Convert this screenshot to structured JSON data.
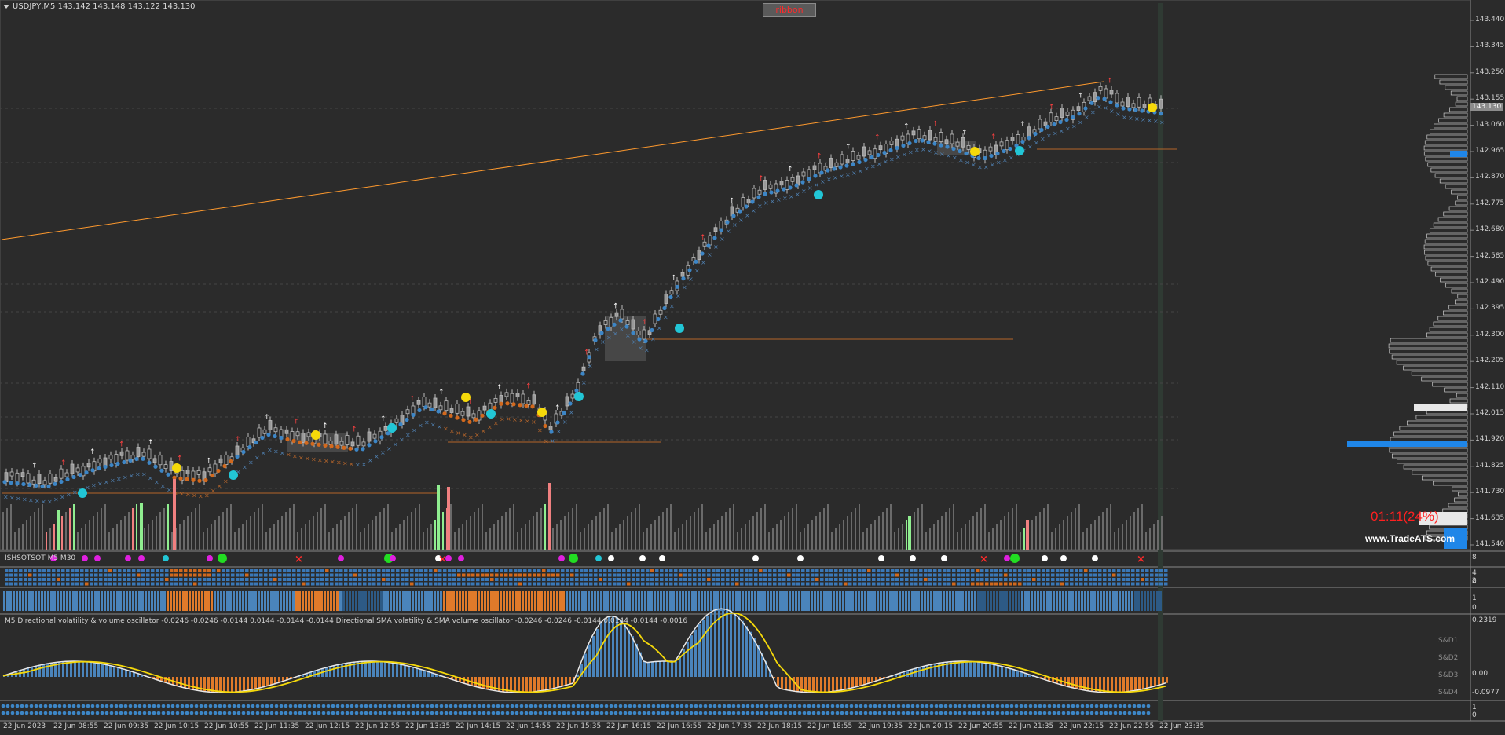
{
  "chart": {
    "symbol_header": "USDJPY,M5  143.142 143.148 143.122 143.130",
    "ribbon_button": "ribbon",
    "current_price": "143.130",
    "timer": "01:11(24%)",
    "watermark": "www.TradeATS.com"
  },
  "price_axis": {
    "labels": [
      "143.440",
      "143.345",
      "143.250",
      "143.155",
      "143.060",
      "142.965",
      "142.870",
      "142.775",
      "142.680",
      "142.585",
      "142.490",
      "142.395",
      "142.300",
      "142.205",
      "142.110",
      "142.015",
      "141.920",
      "141.825",
      "141.730",
      "141.635",
      "141.540"
    ]
  },
  "time_axis": {
    "labels": [
      "22 Jun 2023",
      "22 Jun 08:55",
      "22 Jun 09:35",
      "22 Jun 10:15",
      "22 Jun 10:55",
      "22 Jun 11:35",
      "22 Jun 12:15",
      "22 Jun 12:55",
      "22 Jun 13:35",
      "22 Jun 14:15",
      "22 Jun 14:55",
      "22 Jun 15:35",
      "22 Jun 16:15",
      "22 Jun 16:55",
      "22 Jun 17:35",
      "22 Jun 18:15",
      "22 Jun 18:55",
      "22 Jun 19:35",
      "22 Jun 20:15",
      "22 Jun 20:55",
      "22 Jun 21:35",
      "22 Jun 22:15",
      "22 Jun 22:55",
      "22 Jun 23:35"
    ]
  },
  "panels": {
    "signals": {
      "caption": "ISHSOTSOT M5 M30",
      "axis_top": "8"
    },
    "matrix": {
      "axis": [
        "4",
        "2",
        "0"
      ]
    },
    "trend": {
      "axis": [
        "1",
        "0"
      ]
    },
    "oscillator": {
      "caption": "M5 Directional volatility & volume oscillator -0.0246 -0.0246 -0.0144 0.0144 -0.0144 -0.0144  Directional SMA volatility & SMA volume oscillator -0.0246 -0.0246 -0.0144 0.0144 -0.0144 -0.0016",
      "axis": [
        "0.2319",
        "0.00",
        "-0.0977"
      ],
      "sd_labels": [
        "S&D1",
        "S&D2",
        "S&D3",
        "S&D4"
      ]
    },
    "bottom": {
      "axis": [
        "1",
        "0"
      ]
    }
  },
  "colors": {
    "background": "#2b2b2b",
    "bull_dots": "#3d86c6",
    "bear_dots": "#d2691e",
    "trendline": "#ff9a2e",
    "osc_yellow": "#f5d90a",
    "timer": "#ff2020",
    "volume_profile_highlight": "#1f86e8"
  }
}
